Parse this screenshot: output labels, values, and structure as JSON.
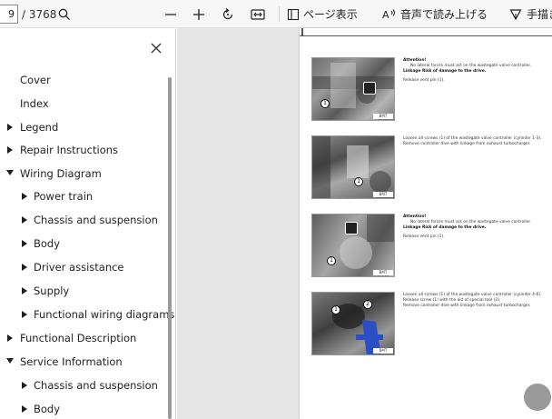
{
  "toolbar": {
    "page_current": "9",
    "page_total": "/ 3768",
    "icons": [
      "search-icon",
      "zoom-out-icon",
      "zoom-in-icon",
      "rotate-icon",
      "fit-page-icon",
      "page-view-icon",
      "read-aloud-icon",
      "draw-icon"
    ],
    "page_view_label": "ページ表示",
    "read_aloud_label": "音声で読み上げる",
    "draw_label": "手描き"
  },
  "sidebar": {
    "close_icon": "close-icon",
    "items": [
      {
        "label": "Cover",
        "level": 0,
        "caret": false
      },
      {
        "label": "Index",
        "level": 0,
        "caret": false
      },
      {
        "label": "Legend",
        "level": 0,
        "caret": "collapsed"
      },
      {
        "label": "Repair Instructions",
        "level": 0,
        "caret": "collapsed"
      },
      {
        "label": "Wiring Diagram",
        "level": 0,
        "caret": "expanded"
      },
      {
        "label": "Power train",
        "level": 1,
        "caret": "collapsed"
      },
      {
        "label": "Chassis and suspension",
        "level": 1,
        "caret": "collapsed"
      },
      {
        "label": "Body",
        "level": 1,
        "caret": "collapsed"
      },
      {
        "label": "Driver assistance",
        "level": 1,
        "caret": "collapsed"
      },
      {
        "label": "Supply",
        "level": 1,
        "caret": "collapsed"
      },
      {
        "label": "Functional wiring diagrams",
        "level": 1,
        "caret": "collapsed"
      },
      {
        "label": "Functional Description",
        "level": 0,
        "caret": "collapsed"
      },
      {
        "label": "Service Information",
        "level": 0,
        "caret": "expanded"
      },
      {
        "label": "Chassis and suspension",
        "level": 1,
        "caret": "collapsed"
      },
      {
        "label": "Body",
        "level": 1,
        "caret": "collapsed"
      }
    ]
  },
  "document": {
    "steps": [
      {
        "photo_tag": "BMT 20901",
        "callouts": [
          "1"
        ],
        "has_warning": true,
        "lines": [
          {
            "text": "Attention!",
            "bold": true
          },
          {
            "text": "No lateral forces must act on the wastegate valve controller.",
            "bold": false
          },
          {
            "text": "Linkage Risk of damage to the drive.",
            "bold": true
          },
          {
            "text": "",
            "bold": false
          },
          {
            "text": "Release vent pin (1).",
            "bold": false
          }
        ]
      },
      {
        "photo_tag": "BMT 20902",
        "callouts": [
          "1"
        ],
        "has_warning": false,
        "lines": [
          {
            "text": "Loosen all screws (1) of the wastegate valve controller (cylinder 1-3).",
            "bold": false
          },
          {
            "text": "Remove controller dive with linkage from exhaust turbocharger.",
            "bold": false
          }
        ]
      },
      {
        "photo_tag": "BMT 20903",
        "callouts": [
          "1"
        ],
        "has_warning": true,
        "lines": [
          {
            "text": "Attention!",
            "bold": true
          },
          {
            "text": "No lateral forces must act on the wastegate valve controller.",
            "bold": false
          },
          {
            "text": "Linkage Risk of damage to the drive.",
            "bold": true
          },
          {
            "text": "",
            "bold": false
          },
          {
            "text": "Release vent pin (1).",
            "bold": false
          }
        ]
      },
      {
        "photo_tag": "BMT 20904",
        "callouts": [
          "1",
          "2"
        ],
        "has_warning": false,
        "lines": [
          {
            "text": "Loosen all screws (1) of the wastegate valve controller (cylinder 4-6).",
            "bold": false
          },
          {
            "text": "Release screw (1) with the aid of special tool (2).",
            "bold": false
          },
          {
            "text": "Remove controller dive with linkage from exhaust turbocharger.",
            "bold": false
          }
        ]
      }
    ]
  },
  "colors": {
    "toolbar_bg": "#f7f7f7",
    "sidebar_bg": "#ffffff",
    "doc_bg": "#e6e6e6",
    "tool_blue": "#2a4fc4"
  }
}
